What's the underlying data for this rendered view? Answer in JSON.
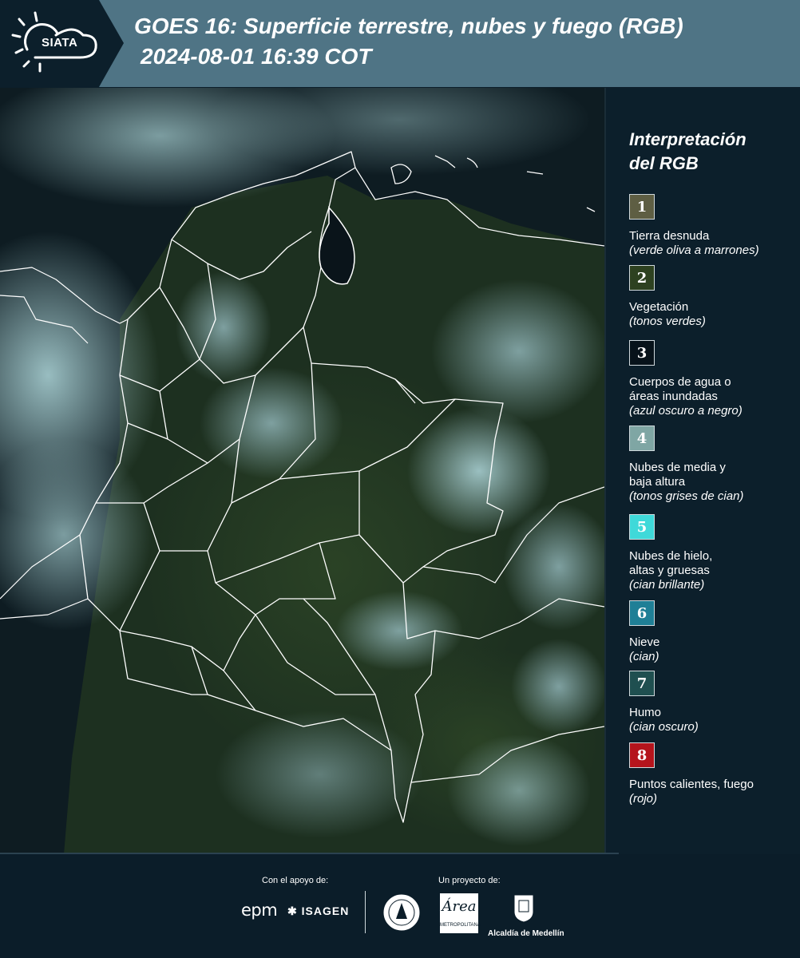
{
  "header": {
    "logo_text": "SIATA",
    "title_line1": "GOES 16: Superficie terrestre, nubes y fuego (RGB)",
    "title_line2": "2024-08-01 16:39 COT",
    "bg_color": "#4f7485"
  },
  "legend": {
    "title_line1": "Interpretación",
    "title_line2": "del RGB",
    "items": [
      {
        "number": "1",
        "label": "Tierra desnuda",
        "note": "(verde oliva a marrones)",
        "color": "#5e5e43"
      },
      {
        "number": "2",
        "label": "Vegetación",
        "note": "(tonos verdes)",
        "color": "#2d4120"
      },
      {
        "number": "3",
        "label": "Cuerpos de agua o áreas inundadas",
        "note": "(azul oscuro a negro)",
        "color": "#07121a"
      },
      {
        "number": "4",
        "label": "Nubes de media y baja altura",
        "note": "(tonos grises de cian)",
        "color": "#7fa6a4"
      },
      {
        "number": "5",
        "label": "Nubes de hielo, altas y gruesas",
        "note": "(cian brillante)",
        "color": "#3fd9d9"
      },
      {
        "number": "6",
        "label": "Nieve",
        "note": "(cian)",
        "color": "#1f7f96"
      },
      {
        "number": "7",
        "label": "Humo",
        "note": "(cian oscuro)",
        "color": "#1f4f50"
      },
      {
        "number": "8",
        "label": "Puntos calientes, fuego",
        "note": "(rojo)",
        "color": "#b5141c"
      }
    ]
  },
  "footer": {
    "support_label": "Con el apoyo de:",
    "project_label": "Un proyecto de:",
    "sponsor_1": "epm",
    "sponsor_2": "ISAGEN",
    "area_logo_text": "Área",
    "area_logo_sub": "METROPOLITANA",
    "alcaldia_text": "Alcaldía de Medellín"
  }
}
